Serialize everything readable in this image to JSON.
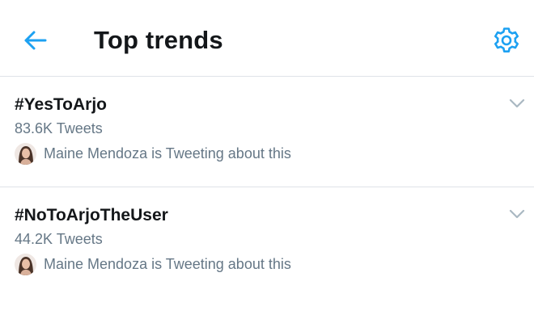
{
  "header": {
    "title": "Top trends",
    "back_icon": "arrow-left-icon",
    "settings_icon": "gear-icon"
  },
  "trends": [
    {
      "name": "#YesToArjo",
      "count": "83.6K Tweets",
      "context": "Maine Mendoza is Tweeting about this",
      "menu_icon": "chevron-down-icon"
    },
    {
      "name": "#NoToArjoTheUser",
      "count": "44.2K Tweets",
      "context": "Maine Mendoza is Tweeting about this",
      "menu_icon": "chevron-down-icon"
    }
  ],
  "colors": {
    "accent": "#1da1f2",
    "primary_text": "#14171a",
    "secondary_text": "#657786",
    "divider": "#dfe3e8",
    "chevron": "#aab8c2"
  }
}
